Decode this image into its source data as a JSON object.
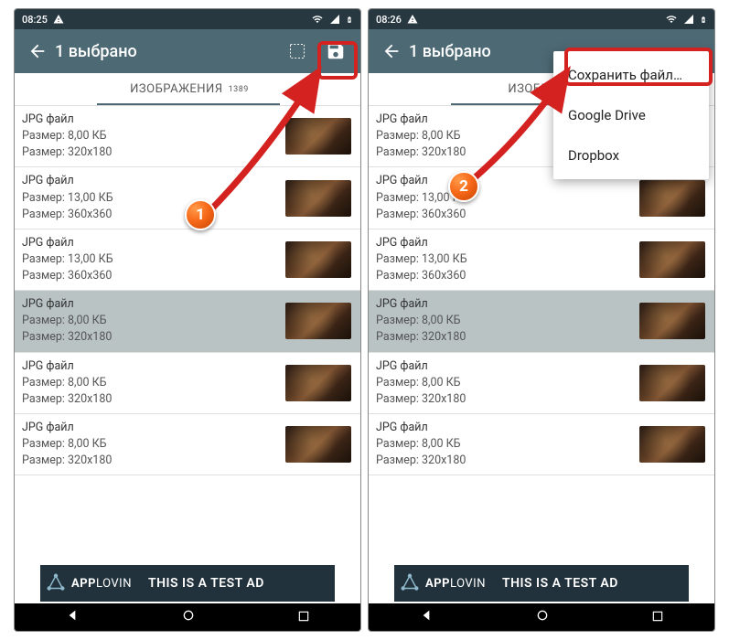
{
  "left": {
    "time": "08:25",
    "title": "1 выбрано",
    "tab_label": "ИЗОБРАЖЕНИЯ",
    "tab_count": "1389",
    "rows": [
      {
        "name": "JPG файл",
        "size": "Размер: 8,00 КБ",
        "dim": "Размер: 320x180",
        "sel": false
      },
      {
        "name": "JPG файл",
        "size": "Размер: 13,00 КБ",
        "dim": "Размер: 360x360",
        "sel": false
      },
      {
        "name": "JPG файл",
        "size": "Размер: 13,00 КБ",
        "dim": "Размер: 360x360",
        "sel": false
      },
      {
        "name": "JPG файл",
        "size": "Размер: 8,00 КБ",
        "dim": "Размер: 320x180",
        "sel": true
      },
      {
        "name": "JPG файл",
        "size": "Размер: 8,00 КБ",
        "dim": "Размер: 320x180",
        "sel": false
      },
      {
        "name": "JPG файл",
        "size": "Размер: 8,00 КБ",
        "dim": "Размер: 320x180",
        "sel": false
      }
    ],
    "ad_brand": "APPLOVIN",
    "ad_text": "THIS IS A TEST AD"
  },
  "right": {
    "time": "08:26",
    "title": "1 выбрано",
    "tab_label": "ИЗОБРАЖЕ",
    "tab_count": "",
    "menu": [
      "Сохранить файл…",
      "Google Drive",
      "Dropbox"
    ],
    "rows": [
      {
        "name": "JPG файл",
        "size": "Размер: 8,00 КБ",
        "dim": "Размер: 320x180",
        "sel": false
      },
      {
        "name": "JPG файл",
        "size": "Размер: 13,00 КБ",
        "dim": "Размер: 360x360",
        "sel": false
      },
      {
        "name": "JPG файл",
        "size": "Размер: 13,00 КБ",
        "dim": "Размер: 360x360",
        "sel": false
      },
      {
        "name": "JPG файл",
        "size": "Размер: 8,00 КБ",
        "dim": "Размер: 320x180",
        "sel": true
      },
      {
        "name": "JPG файл",
        "size": "Размер: 8,00 КБ",
        "dim": "Размер: 320x180",
        "sel": false
      },
      {
        "name": "JPG файл",
        "size": "Размер: 8,00 КБ",
        "dim": "Размер: 320x180",
        "sel": false
      }
    ],
    "ad_brand": "APPLOVIN",
    "ad_text": "THIS IS A TEST AD"
  },
  "badges": {
    "one": "1",
    "two": "2"
  }
}
